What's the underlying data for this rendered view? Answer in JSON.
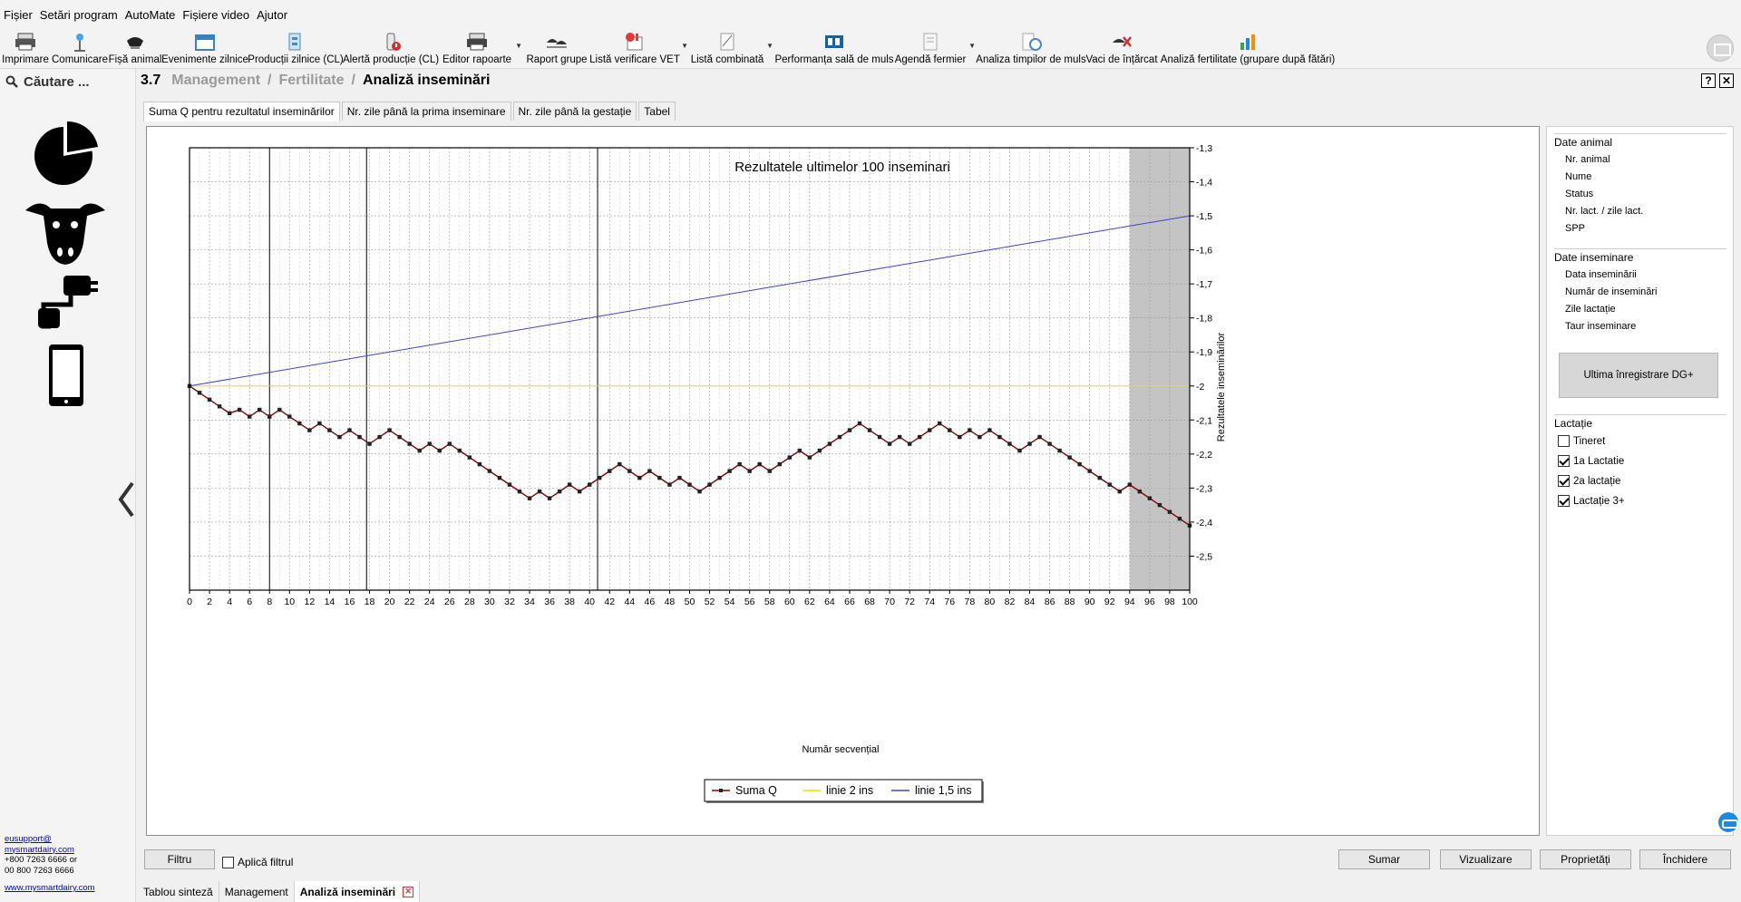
{
  "menu": [
    "Fișier",
    "Setări program",
    "AutoMate",
    "Fișiere video",
    "Ajutor"
  ],
  "toolbar": [
    {
      "label": "Imprimare",
      "icon": "printer-icon"
    },
    {
      "label": "Comunicare",
      "icon": "antenna-icon"
    },
    {
      "label": "Fișă animal",
      "icon": "cow-card-icon"
    },
    {
      "label": "Evenimente zilnice",
      "icon": "calendar-icon"
    },
    {
      "label": "Producții zilnice (CL)",
      "icon": "production-icon"
    },
    {
      "label": "Alertă producție (CL)",
      "icon": "alert-bottle-icon"
    },
    {
      "label": "Editor rapoarte",
      "icon": "printer-report-icon"
    },
    {
      "label": "Raport grupe",
      "icon": "cow-group-icon"
    },
    {
      "label": "Listă verificare VET",
      "icon": "vet-check-icon"
    },
    {
      "label": "Listă combinată",
      "icon": "combined-list-icon"
    },
    {
      "label": "Performanța sală de muls",
      "icon": "milking-parlor-icon"
    },
    {
      "label": "Agendă fermier",
      "icon": "agenda-icon"
    },
    {
      "label": "Analiza timpilor de muls",
      "icon": "milking-time-icon"
    },
    {
      "label": "Vaci de înțărcat",
      "icon": "cow-cross-icon"
    },
    {
      "label": "Analiză fertilitate (grupare după fătări)",
      "icon": "fertility-chart-icon"
    }
  ],
  "search": {
    "placeholder": "Căutare ..."
  },
  "breadcrumb": {
    "number": "3.7",
    "parent1": "Management",
    "parent2": "Fertilitate",
    "current": "Analiză inseminări"
  },
  "help": {
    "help_label": "?",
    "close_label": "✕"
  },
  "tabs": [
    "Suma Q pentru rezultatul inseminărilor",
    "Nr. zile până la prima inseminare",
    "Nr. zile până la gestație",
    "Tabel"
  ],
  "chart_data": {
    "type": "line",
    "title": "Rezultatele ultimelor 100 inseminari",
    "xlabel": "Număr secvențial",
    "ylabel": "Rezultatele inseminărilor",
    "xlim": [
      0,
      100
    ],
    "ylim": [
      -2.6,
      -1.3
    ],
    "x_ticks": [
      0,
      2,
      4,
      6,
      8,
      10,
      12,
      14,
      16,
      18,
      20,
      22,
      24,
      26,
      28,
      30,
      32,
      34,
      36,
      38,
      40,
      42,
      44,
      46,
      48,
      50,
      52,
      54,
      56,
      58,
      60,
      62,
      64,
      66,
      68,
      70,
      72,
      74,
      76,
      78,
      80,
      82,
      84,
      86,
      88,
      90,
      92,
      94,
      96,
      98,
      100
    ],
    "y_ticks": [
      "-1,3",
      "-1,4",
      "-1,5",
      "-1,6",
      "-1,7",
      "-1,8",
      "-1,9",
      "-2",
      "-2,1",
      "-2,2",
      "-2,3",
      "-2,4",
      "-2,5"
    ],
    "y_tick_values": [
      -1.3,
      -1.4,
      -1.5,
      -1.6,
      -1.7,
      -1.8,
      -1.9,
      -2.0,
      -2.1,
      -2.2,
      -2.3,
      -2.4,
      -2.5
    ],
    "vertical_markers": [
      8,
      17.7,
      40.8
    ],
    "shaded_x_range": [
      94,
      100
    ],
    "grid": true,
    "legend_position": "bottom-center",
    "series": [
      {
        "name": "Suma Q",
        "color": "#8b0000",
        "values": [
          -2,
          -2.02,
          -2.04,
          -2.06,
          -2.08,
          -2.07,
          -2.09,
          -2.07,
          -2.09,
          -2.07,
          -2.09,
          -2.11,
          -2.13,
          -2.11,
          -2.13,
          -2.15,
          -2.13,
          -2.15,
          -2.17,
          -2.15,
          -2.13,
          -2.15,
          -2.17,
          -2.19,
          -2.17,
          -2.19,
          -2.17,
          -2.19,
          -2.21,
          -2.23,
          -2.25,
          -2.27,
          -2.29,
          -2.31,
          -2.33,
          -2.31,
          -2.33,
          -2.31,
          -2.29,
          -2.31,
          -2.29,
          -2.27,
          -2.25,
          -2.23,
          -2.25,
          -2.27,
          -2.25,
          -2.27,
          -2.29,
          -2.27,
          -2.29,
          -2.31,
          -2.29,
          -2.27,
          -2.25,
          -2.23,
          -2.25,
          -2.23,
          -2.25,
          -2.23,
          -2.21,
          -2.19,
          -2.21,
          -2.19,
          -2.17,
          -2.15,
          -2.13,
          -2.11,
          -2.13,
          -2.15,
          -2.17,
          -2.15,
          -2.17,
          -2.15,
          -2.13,
          -2.11,
          -2.13,
          -2.15,
          -2.13,
          -2.15,
          -2.13,
          -2.15,
          -2.17,
          -2.19,
          -2.17,
          -2.15,
          -2.17,
          -2.19,
          -2.21,
          -2.23,
          -2.25,
          -2.27,
          -2.29,
          -2.31,
          -2.29,
          -2.31,
          -2.33,
          -2.35,
          -2.37,
          -2.39,
          -2.41
        ]
      },
      {
        "name": "linie 2 ins",
        "color": "#e6e600",
        "x": [
          0,
          100
        ],
        "values": [
          -2,
          -2
        ]
      },
      {
        "name": "linie 1,5 ins",
        "color": "#4040d0",
        "x": [
          0,
          100
        ],
        "values": [
          -2,
          -1.5
        ]
      }
    ]
  },
  "side": {
    "animal_title": "Date animal",
    "animal_items": [
      "Nr. animal",
      "Nume",
      "Status",
      "Nr. lact. / zile lact.",
      "SPP"
    ],
    "insem_title": "Date inseminare",
    "insem_items": [
      "Data inseminării",
      "Număr de inseminări",
      "Zile lactație",
      "Taur inseminare"
    ],
    "dg_button": "Ultima înregistrare DG+",
    "lact_title": "Lactație",
    "lact_items": [
      {
        "label": "Tineret",
        "checked": false
      },
      {
        "label": "1a Lactatie",
        "checked": true
      },
      {
        "label": "2a lactație",
        "checked": true
      },
      {
        "label": "Lactație 3+",
        "checked": true
      }
    ]
  },
  "contact": {
    "email1": "eusupport@",
    "email2": "mysmartdairy.com",
    "phone1": "+800 7263 6666 or",
    "phone2": "00 800 7263 6666",
    "web": "www.mysmartdairy.com"
  },
  "bottom": {
    "filter_button": "Filtru",
    "apply_filter": "Aplică filtrul",
    "sum": "Sumar",
    "view": "Vizualizare",
    "props": "Proprietăți",
    "close": "Închidere"
  },
  "bottom_tabs": [
    "Tablou sinteză",
    "Management",
    "Analiză inseminări"
  ]
}
